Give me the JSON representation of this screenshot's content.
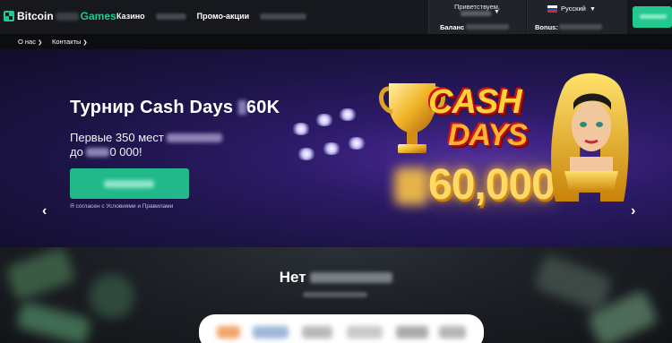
{
  "header": {
    "logo": {
      "part1": "Bitcoin",
      "part2": "Games"
    },
    "nav": [
      {
        "label": "Казино"
      },
      {
        "label": "Промо-акции"
      }
    ],
    "greeting": "Приветствуем,",
    "balance_label": "Баланс",
    "bonus_label": "Bonus:",
    "language": "Русский"
  },
  "subnav": [
    {
      "label": "О нас"
    },
    {
      "label": "Контакты"
    }
  ],
  "hero": {
    "title_prefix": "Турнир Cash Days",
    "title_suffix": "60K",
    "sub_line1": "Первые 350 мест",
    "sub_line2_prefix": "до",
    "sub_line2_suffix": "0 000!",
    "terms": "Я согласен с Условиями и Правилами",
    "art_cash": "CASH",
    "art_days": "DAYS",
    "art_amount": "60,000"
  },
  "lower": {
    "title_prefix": "Нет"
  },
  "colors": {
    "accent": "#21c98f",
    "header_bg": "#16181d",
    "hero_bg": "#2c1a67"
  }
}
